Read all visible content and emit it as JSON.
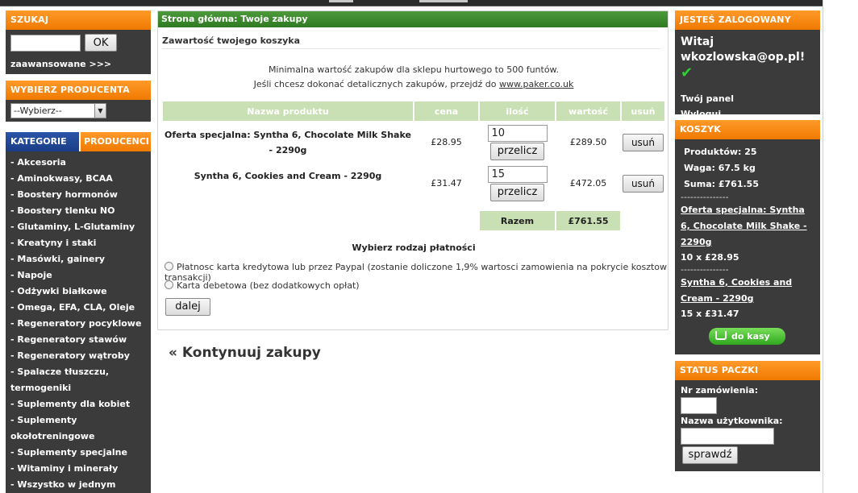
{
  "left": {
    "search": {
      "title": "SZUKAJ",
      "ok": "OK",
      "advanced": "zaawansowane >>>",
      "value": ""
    },
    "producer": {
      "title": "WYBIERZ PRODUCENTA",
      "selected": "--Wybierz--"
    },
    "categories": {
      "tab_active": "KATEGORIE",
      "tab_other": "PRODUCENCI",
      "items": [
        "- Akcesoria",
        "- Aminokwasy, BCAA",
        "- Boostery hormonów",
        "- Boostery tlenku NO",
        "- Glutaminy, L-Glutaminy",
        "- Kreatyny i staki",
        "- Masówki, gainery",
        "- Napoje",
        "- Odżywki białkowe",
        "- Omega, EFA, CLA, Oleje",
        "- Regeneratory pocyklowe",
        "- Regeneratory stawów",
        "- Regeneratory wątroby",
        "- Spalacze tłuszczu,",
        "termogeniki",
        "- Suplementy dla kobiet",
        "- Suplementy",
        "okołotreningowe",
        "- Suplementy specjalne",
        "- Witaminy i minerały",
        "- Wszystko w jednym"
      ]
    }
  },
  "main": {
    "breadcrumb": "Strona główna: Twoje zakupy",
    "cart_title": "Zawartość twojego koszyka",
    "info_line1": "Minimalna wartość zakupów dla sklepu hurtowego to 500 funtów.",
    "info_line2_text": "Jeśli chcesz dokonać detalicznych zakupów, przejdź do",
    "info_link": "www.paker.co.uk",
    "columns": [
      "Nazwa produktu",
      "cena",
      "ilość",
      "wartość",
      "usuń"
    ],
    "rows": [
      {
        "name": "Oferta specjalna: Syntha 6, Chocolate Milk Shake - 2290g",
        "price": "£28.95",
        "qty": "10",
        "value": "£289.50"
      },
      {
        "name": "Syntha 6, Cookies and Cream - 2290g",
        "price": "£31.47",
        "qty": "15",
        "value": "£472.05"
      }
    ],
    "recalc_label": "przelicz",
    "delete_label": "usuń",
    "total_label": "Razem",
    "total_value": "£761.55",
    "payment_title": "Wybierz rodzaj płatności",
    "payment_options": [
      "Płatnosc karta kredytowa lub przez Paypal (zostanie doliczone 1,9% wartosci zamowienia na pokrycie kosztow transakcji)",
      "Karta debetowa (bez dodatkowych opłat)"
    ],
    "next_label": "dalej",
    "continue_label": "« Kontynuuj zakupy"
  },
  "right": {
    "login": {
      "title": "JESTEŚ ZALOGOWANY",
      "greeting": "Witaj",
      "email": "wkozlowska@op.pl!",
      "panel": "Twój panel",
      "logout": "Wyloguj"
    },
    "cart": {
      "title": "KOSZYK",
      "products": "Produktów: 25",
      "weight": "Waga: 67.5 kg",
      "sum": "Suma: £761.55",
      "separator": "---------------",
      "items": [
        {
          "name": "Oferta specjalna: Syntha 6, Chocolate Milk Shake - 2290g",
          "qty": "10 x £28.95"
        },
        {
          "name": "Syntha 6, Cookies and Cream - 2290g",
          "qty": "15 x £31.47"
        }
      ],
      "checkout": "do kasy"
    },
    "status": {
      "title": "STATUS PACZKI",
      "order_label": "Nr zamówienia:",
      "user_label": "Nazwa użytkownika:",
      "check": "sprawdź"
    }
  },
  "colors": {
    "orange": "#f07a00",
    "green_header": "#2f7a22",
    "table_header": "#c9dfb4",
    "dark_panel": "#3b3b3b",
    "blue_tab": "#1a3d86"
  }
}
